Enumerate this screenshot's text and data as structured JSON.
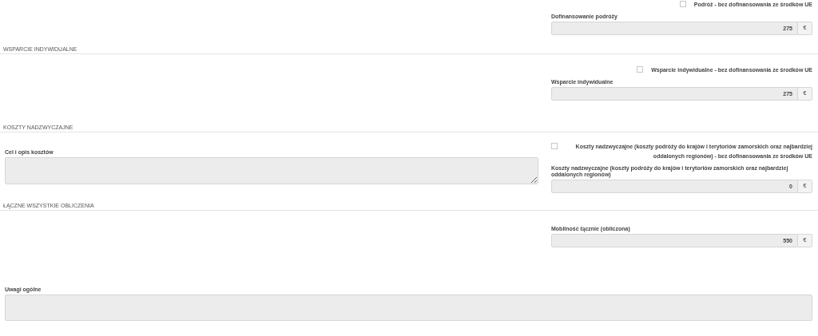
{
  "sections": [
    {
      "checkbox": {
        "label": "Podróż - bez dofinansowania ze środków UE",
        "checked": false
      },
      "field": {
        "label": "Dofinansowanie podróży",
        "value": "275",
        "unit": "€"
      }
    },
    {
      "title": "WSPARCIE INDYWIDUALNE",
      "checkbox": {
        "label": "Wsparcie indywidualne - bez dofinansowania ze środków UE",
        "checked": false
      },
      "field": {
        "label": "Wsparcie indywidualne",
        "value": "275",
        "unit": "€"
      }
    },
    {
      "title": "KOSZTY NADZWYCZAJNE",
      "textarea": {
        "label": "Cel i opis kosztów"
      },
      "checkbox": {
        "label": "Koszty nadzwyczajne (koszty podróży do krajów i terytoriów zamorskich oraz najbardziej oddalonych regionów) - bez dofinansowania ze środków UE",
        "checked": false
      },
      "field": {
        "label": "Koszty nadzwyczajne (koszty podróży do krajów i terytoriów zamorskich oraz najbardziej oddalonych regionów)",
        "value": "0",
        "unit": "€"
      }
    },
    {
      "title": "ŁĄCZNE WSZYSTKIE OBLICZENIA",
      "field": {
        "label": "Mobilność łącznie (obliczona)",
        "value": "550",
        "unit": "€"
      }
    }
  ],
  "general_remarks": {
    "label": "Uwagi ogólne"
  }
}
